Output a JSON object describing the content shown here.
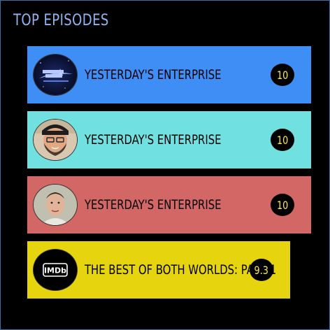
{
  "header": {
    "title": "TOP EPISODES"
  },
  "episodes": [
    {
      "title": "YESTERDAY'S ENTERPRISE",
      "score": "10",
      "color": "#3f8ef5",
      "avatar": "star-trek-logo-icon"
    },
    {
      "title": "YESTERDAY'S ENTERPRISE",
      "score": "10",
      "color": "#71e0e0",
      "avatar": "bearded-man-avatar"
    },
    {
      "title": "YESTERDAY'S ENTERPRISE",
      "score": "10",
      "color": "#d36765",
      "avatar": "man-avatar"
    },
    {
      "title": "THE BEST OF BOTH WORLDS: PART 1",
      "score": "9.3",
      "color": "#e6d40e",
      "avatar": "imdb-logo-icon"
    }
  ],
  "logo_text": {
    "imdb": "IMDb"
  }
}
